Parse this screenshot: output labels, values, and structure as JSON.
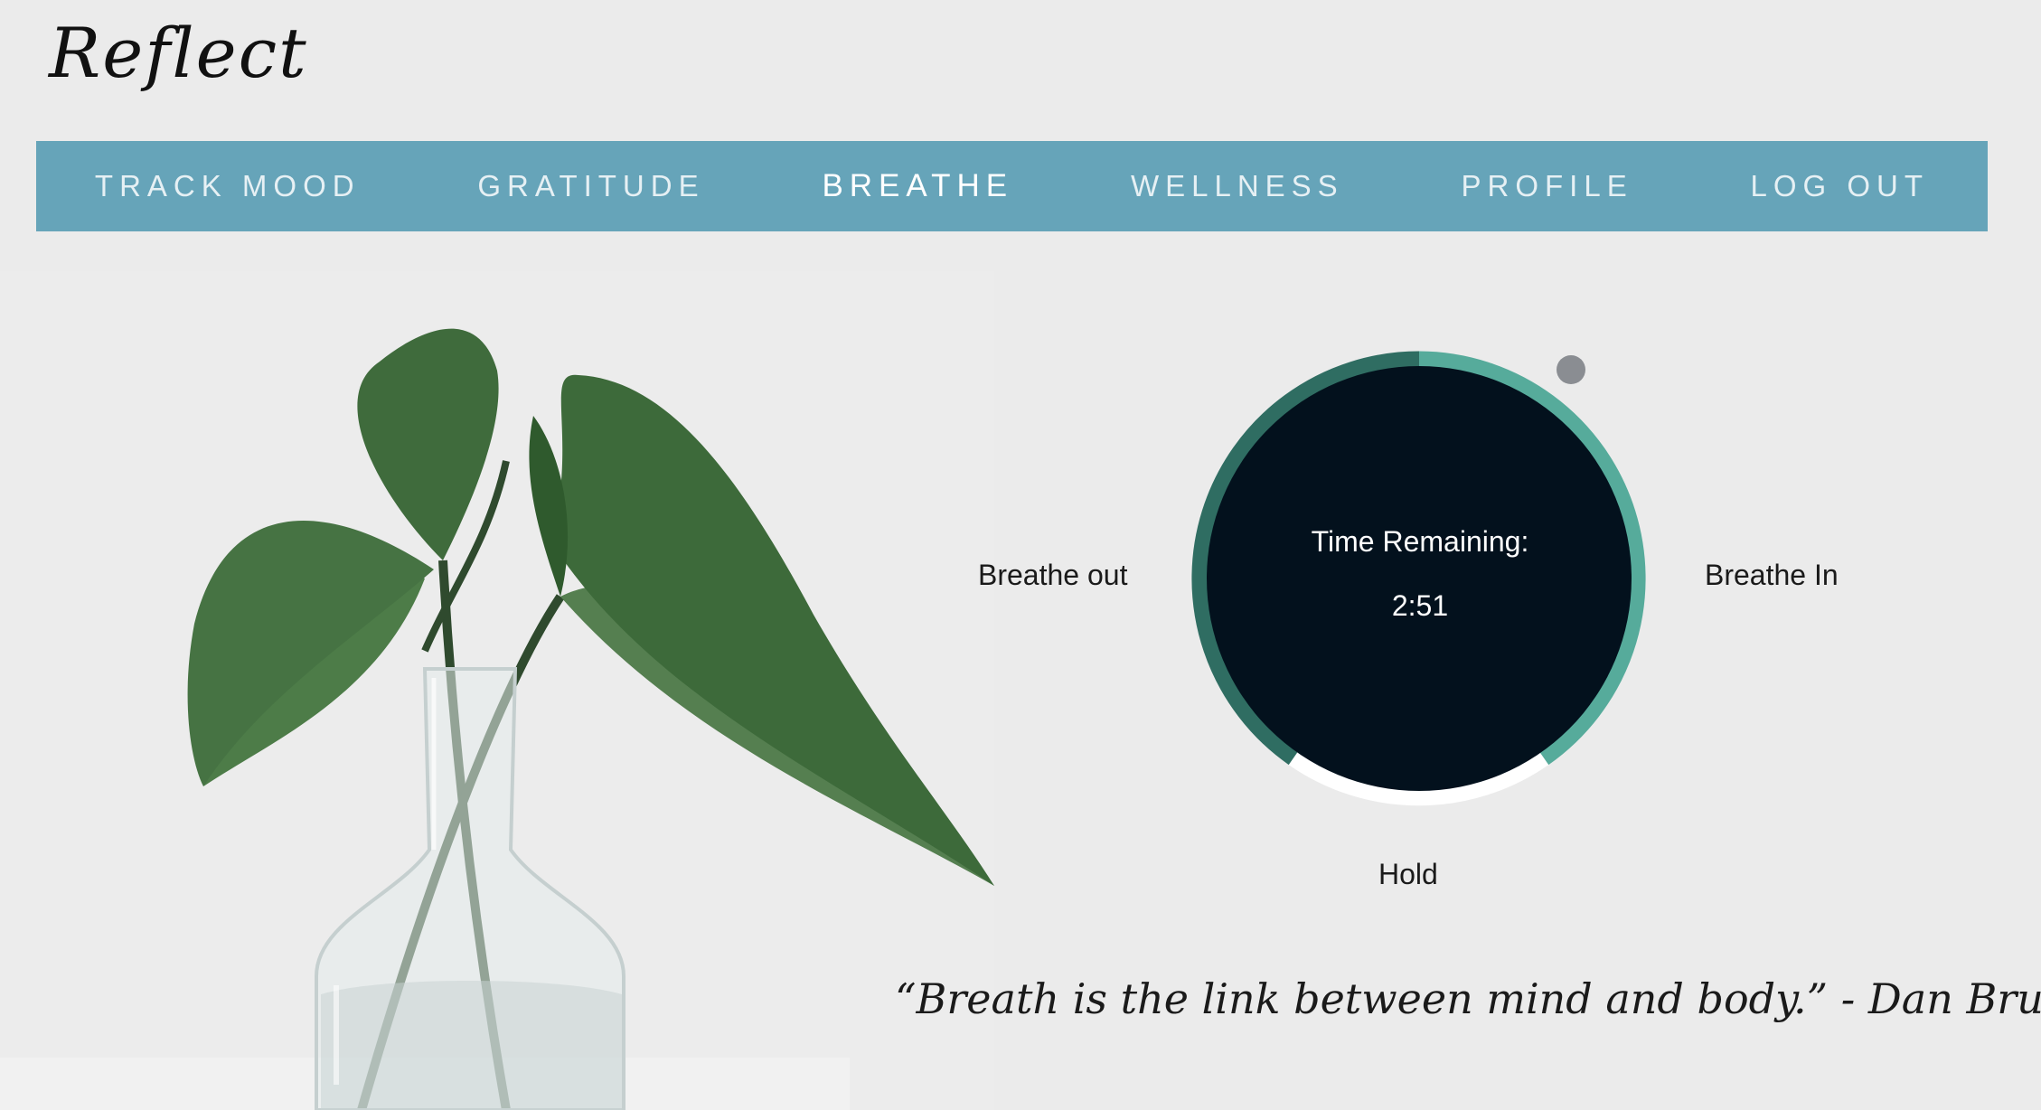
{
  "app": {
    "logo_text": "Reflect"
  },
  "nav": {
    "items": [
      {
        "label": "TRACK MOOD",
        "active": false
      },
      {
        "label": "GRATITUDE",
        "active": false
      },
      {
        "label": "BREATHE",
        "active": true
      },
      {
        "label": "WELLNESS",
        "active": false
      },
      {
        "label": "PROFILE",
        "active": false
      },
      {
        "label": "LOG OUT",
        "active": false
      }
    ]
  },
  "breathe": {
    "phase_labels": {
      "out": "Breathe out",
      "in": "Breathe In",
      "hold": "Hold"
    },
    "timer_title": "Time Remaining:",
    "timer_value": "2:51"
  },
  "quote": {
    "text": "“Breath is the link between mind and body.” - Dan Brule"
  },
  "colors": {
    "nav_background": "#66a4b9",
    "timer_face": "#03111d",
    "ring_dark": "#2f6d62",
    "ring_light": "#56ab9b",
    "ring_remaining": "#ffffff",
    "position_dot": "#8a8d92"
  },
  "icons": {
    "position_marker": "progress-dot-icon",
    "illustration": "plant-in-vase-image"
  }
}
